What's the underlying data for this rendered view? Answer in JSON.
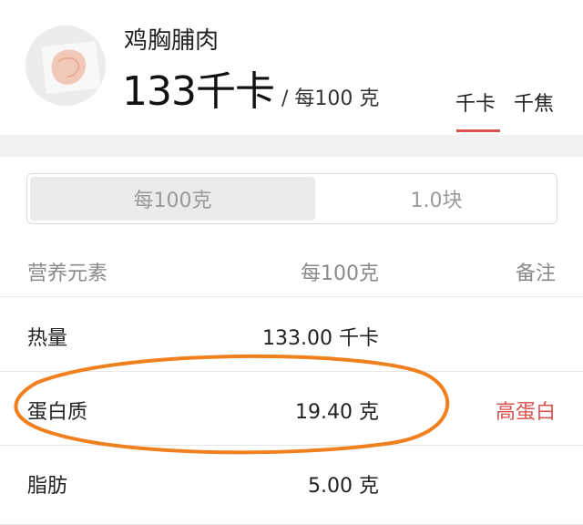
{
  "food": {
    "name": "鸡胸脯肉",
    "energy_value": "133千卡",
    "energy_basis": "/ 每100 克",
    "image_icon": "chicken-breast-photo"
  },
  "unit_tabs": {
    "items": [
      "千卡",
      "千焦"
    ],
    "selected": "千卡"
  },
  "portion_selector": {
    "options": [
      "每100克",
      "1.0块"
    ],
    "selected": "每100克"
  },
  "nutrition_table": {
    "headers": {
      "name": "营养元素",
      "value": "每100克",
      "note": "备注"
    },
    "rows": [
      {
        "name": "热量",
        "value": "133.00 千卡",
        "note": ""
      },
      {
        "name": "蛋白质",
        "value": "19.40 克",
        "note": "高蛋白"
      },
      {
        "name": "脂肪",
        "value": "5.00 克",
        "note": ""
      }
    ]
  },
  "colors": {
    "accent": "#d9534f",
    "highlight_ring": "#f07f1e"
  }
}
